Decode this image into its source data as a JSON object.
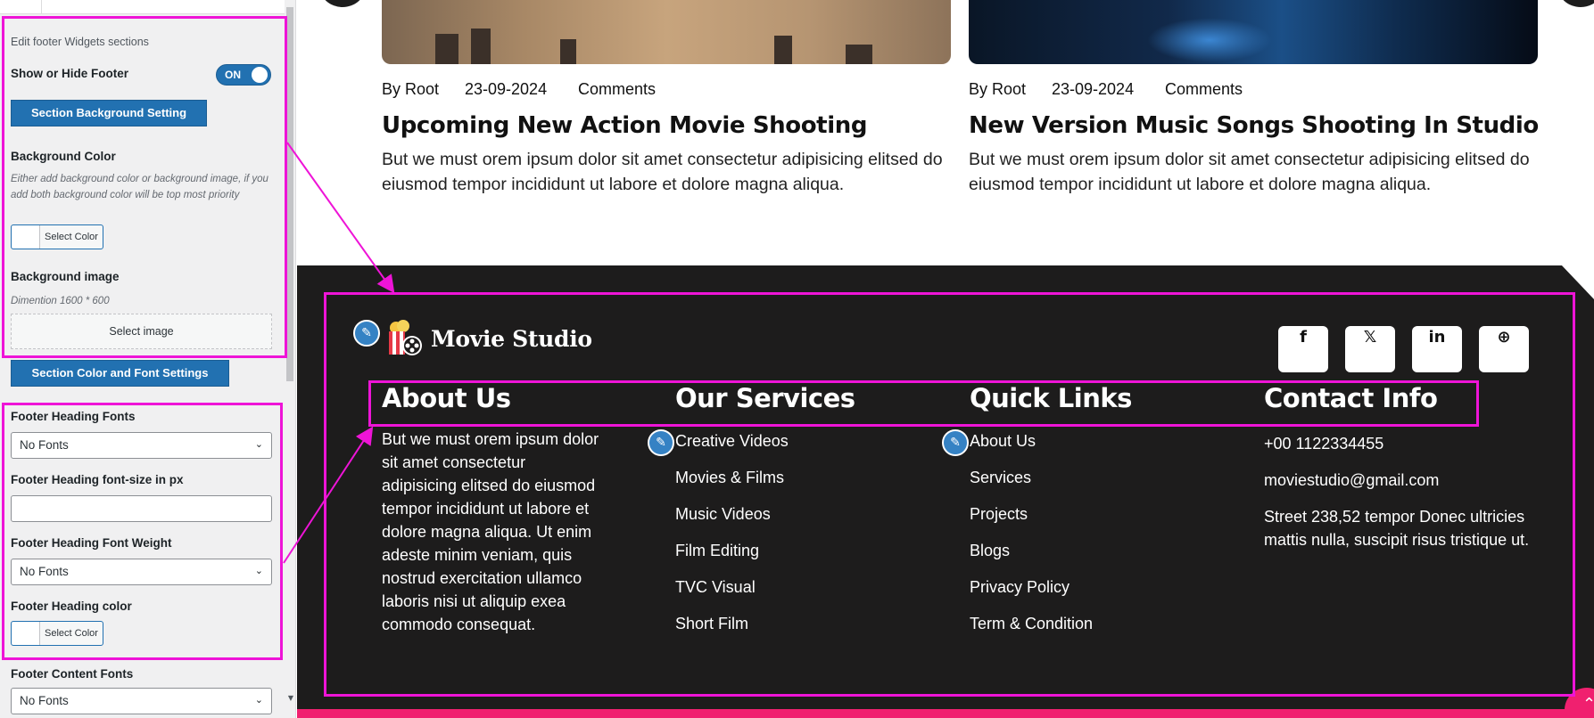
{
  "panel": {
    "section_desc": "Edit footer Widgets sections",
    "show_hide_label": "Show or Hide Footer",
    "toggle_state": "ON",
    "section_bg_btn": "Section Background Setting",
    "bg_color_label": "Background Color",
    "bg_color_note": "Either add background color or background image, if you add both background color will be top most priority",
    "select_color": "Select Color",
    "bg_image_label": "Background image",
    "bg_image_note": "Dimention 1600 * 600",
    "select_image": "Select image",
    "color_font_btn": "Section Color and Font Settings",
    "heading_fonts_label": "Footer Heading Fonts",
    "heading_fonts_value": "No Fonts",
    "heading_size_label": "Footer Heading font-size in px",
    "heading_size_value": "",
    "heading_weight_label": "Footer Heading Font Weight",
    "heading_weight_value": "No Fonts",
    "heading_color_label": "Footer Heading color",
    "content_fonts_label": "Footer Content Fonts",
    "content_fonts_value": "No Fonts"
  },
  "posts": [
    {
      "author": "By Root",
      "date": "23-09-2024",
      "comments": "Comments",
      "title": "Upcoming New Action Movie Shooting",
      "excerpt": "But we must orem ipsum dolor sit amet consectetur adipisicing elitsed do eiusmod tempor incididunt ut labore et dolore magna aliqua."
    },
    {
      "author": "By Root",
      "date": "23-09-2024",
      "comments": "Comments",
      "title": "New Version Music Songs Shooting In Studio",
      "excerpt": "But we must orem ipsum dolor sit amet consectetur adipisicing elitsed do eiusmod tempor incididunt ut labore et dolore magna aliqua."
    }
  ],
  "footer": {
    "brand": "Movie Studio",
    "social": [
      "f",
      "𝕏",
      "in",
      "⊕"
    ],
    "about": {
      "heading": "About Us",
      "text": "But we must orem ipsum dolor sit amet consectetur adipisicing elitsed do eiusmod tempor incididunt ut labore et dolore magna aliqua. Ut enim adeste minim veniam, quis nostrud exercitation ullamco laboris nisi ut aliquip exea commodo consequat."
    },
    "services": {
      "heading": "Our Services",
      "items": [
        "Creative Videos",
        "Movies & Films",
        "Music Videos",
        "Film Editing",
        "TVC Visual",
        "Short Film"
      ]
    },
    "links": {
      "heading": "Quick Links",
      "items": [
        "About Us",
        "Services",
        "Projects",
        "Blogs",
        "Privacy Policy",
        "Term & Condition"
      ]
    },
    "contact": {
      "heading": "Contact Info",
      "phone": "+00 1122334455",
      "email": "moviestudio@gmail.com",
      "address": "Street 238,52 tempor Donec ultricies mattis nulla, suscipit risus tristique ut."
    }
  },
  "colors": {
    "annotation": "#ee14d7",
    "wp_blue": "#2271b1",
    "footer_bg": "#1d1c1c",
    "accent": "#f0206f"
  },
  "icons": {
    "edit": "pencil-icon",
    "scroll_top": "double-chevron-up-icon",
    "logo": "popcorn-film-reel-icon"
  }
}
